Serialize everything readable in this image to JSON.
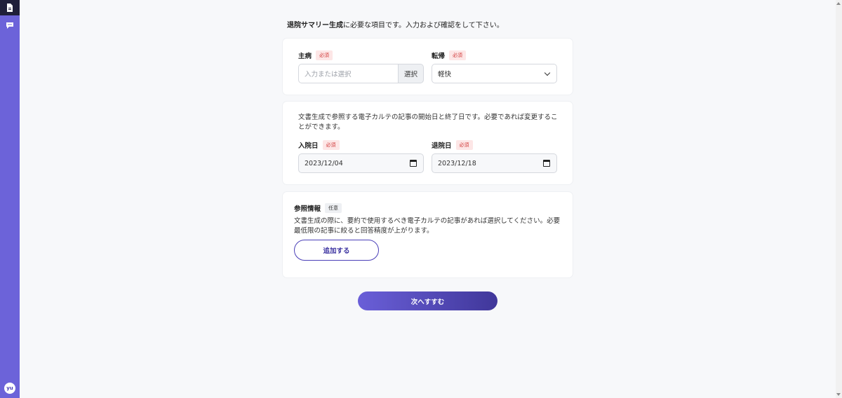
{
  "sidebar": {
    "doc_icon": "document-icon",
    "chat_icon": "chat-icon",
    "avatar_text": "yu"
  },
  "intro": {
    "bold": "退院サマリー生成",
    "rest": "に必要な項目です。入力および確認をして下さい。"
  },
  "card1": {
    "main_disease_label": "主病",
    "main_disease_badge": "必須",
    "main_disease_placeholder": "入力または選択",
    "select_button": "選択",
    "outcome_label": "転帰",
    "outcome_badge": "必須",
    "outcome_value": "軽快"
  },
  "card2": {
    "description": "文書生成で参照する電子カルテの記事の開始日と終了日です。必要であれば変更することができます。",
    "admission_label": "入院日",
    "admission_badge": "必須",
    "admission_value": "2023/12/04",
    "discharge_label": "退院日",
    "discharge_badge": "必須",
    "discharge_value": "2023/12/18"
  },
  "card3": {
    "ref_label": "参照情報",
    "ref_badge": "任意",
    "description": "文書生成の際に、要約で使用するべき電子カルテの記事があれば選択してください。必要最低限の記事に絞ると回答精度が上がります。",
    "add_button": "追加する"
  },
  "next_button": "次へすすむ",
  "colors": {
    "sidebar": "#6c63d9",
    "accent": "#4a3fb8",
    "required": "#d03a3a"
  }
}
